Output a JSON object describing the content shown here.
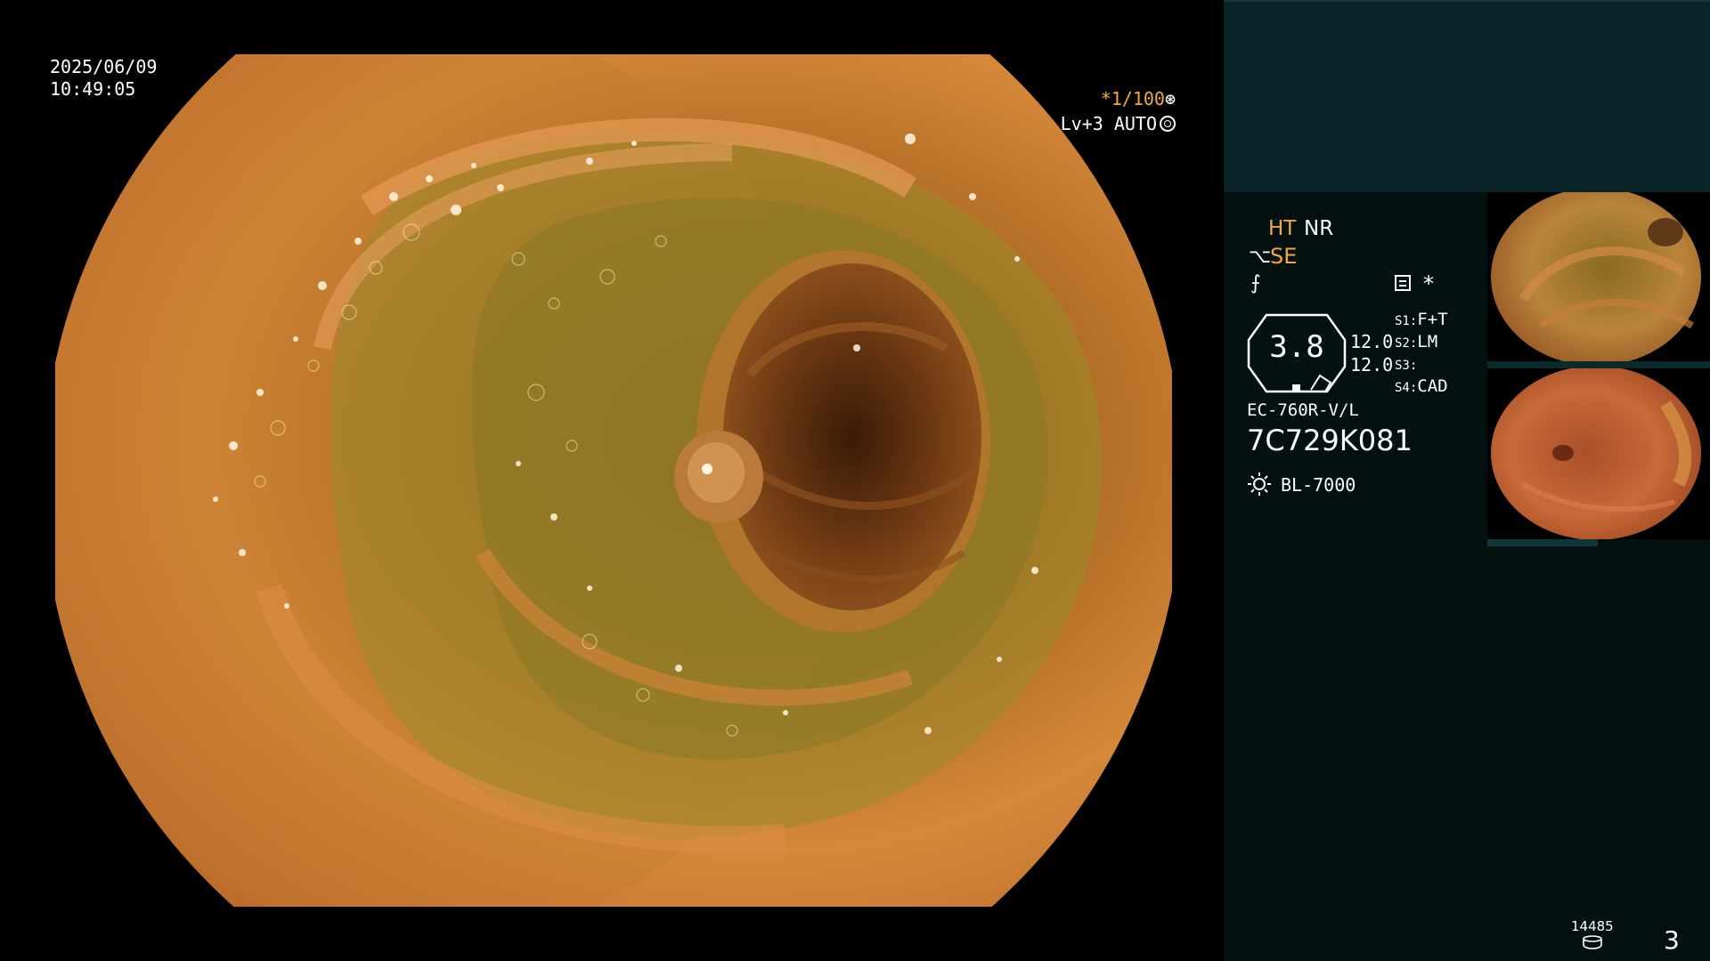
{
  "overlay": {
    "date": "2025/06/09",
    "time": "10:49:05",
    "shutter": "*1/100",
    "shutter_icon": "gear-icon",
    "level": "Lv+3 AUTO",
    "level_icon": "ring-icon"
  },
  "panel": {
    "ht": "HT",
    "nr": "NR",
    "se_icon": "⌥",
    "se": "SE",
    "enh_icon": "⨍",
    "star": "*",
    "iris_value": "3.8",
    "iris_a": "12.0",
    "iris_b": "12.0",
    "slots": [
      {
        "key": "S1:",
        "value": "F+T"
      },
      {
        "key": "S2:",
        "value": "LM"
      },
      {
        "key": "S3:",
        "value": ""
      },
      {
        "key": "S4:",
        "value": "CAD"
      }
    ],
    "scope_model": "EC-760R-V/L",
    "scope_serial": "7C729K081",
    "light_source": "BL-7000",
    "counter": "14485",
    "page": "3"
  },
  "colors": {
    "accent_orange": "#f2a93b",
    "panel_bg": "#051011",
    "panel_top": "#0a2628"
  }
}
